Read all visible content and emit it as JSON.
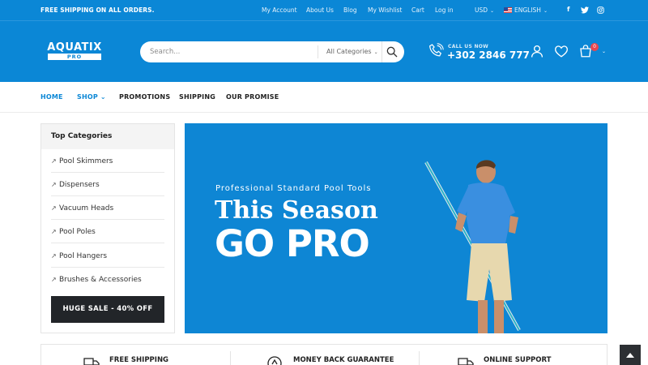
{
  "topbar": {
    "promo": "FREE SHIPPING ON ALL ORDERS.",
    "links": [
      "My Account",
      "About Us",
      "Blog",
      "My Wishlist",
      "Cart",
      "Log in"
    ],
    "currency": "USD",
    "language": "ENGLISH"
  },
  "social": [
    "f",
    "t",
    "◎"
  ],
  "logo": {
    "word": "AQUATIX",
    "sub": "PRO"
  },
  "search": {
    "placeholder": "Search...",
    "category": "All Categories"
  },
  "call": {
    "label": "CALL US NOW",
    "number": "+302 2846 777"
  },
  "cart": {
    "count": "0"
  },
  "nav": [
    "HOME",
    "SHOP",
    "PROMOTIONS",
    "SHIPPING",
    "OUR PROMISE"
  ],
  "sidebar": {
    "title": "Top Categories",
    "items": [
      "Pool Skimmers",
      "Dispensers",
      "Vacuum Heads",
      "Pool Poles",
      "Pool Hangers",
      "Brushes & Accessories"
    ],
    "sale": "HUGE SALE - 40% OFF"
  },
  "banner": {
    "subtitle": "Professional Standard Pool Tools",
    "line1": "This Season",
    "line2": "GO PRO"
  },
  "features": [
    "FREE SHIPPING",
    "MONEY BACK GUARANTEE",
    "ONLINE SUPPORT"
  ],
  "colors": {
    "primary": "#0b87d6",
    "dark": "#222529",
    "badge": "#e8464e"
  }
}
